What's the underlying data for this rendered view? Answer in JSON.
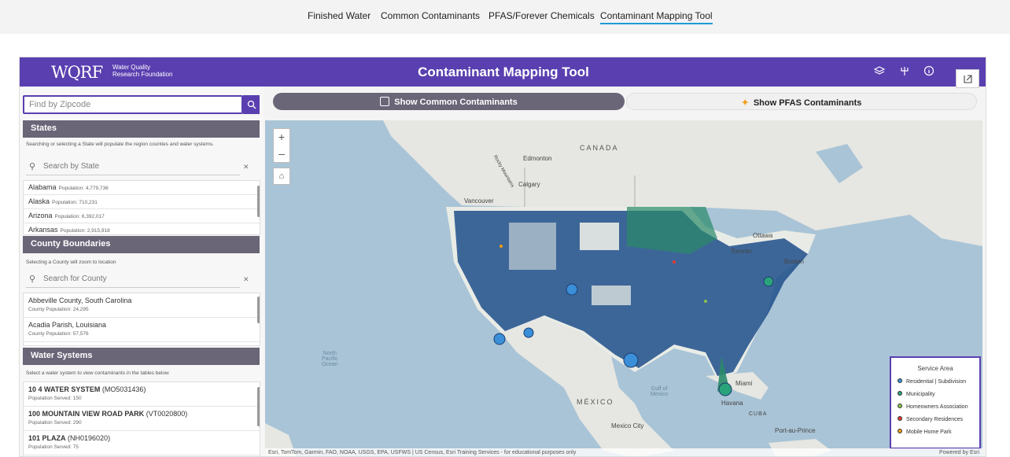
{
  "topnav": {
    "items": [
      {
        "label": "Finished Water"
      },
      {
        "label": "Common Contaminants"
      },
      {
        "label": "PFAS/Forever Chemicals"
      },
      {
        "label": "Contaminant Mapping Tool"
      }
    ]
  },
  "header": {
    "logo_text": "WQRF",
    "logo_sub_line1": "Water Quality",
    "logo_sub_line2": "Research Foundation",
    "title": "Contaminant Mapping Tool",
    "icons": [
      "layers-icon",
      "share-icon",
      "info-icon"
    ],
    "color": "#5a3fb0"
  },
  "zip_search": {
    "placeholder": "Find by Zipcode",
    "icon": "search-icon"
  },
  "states": {
    "title": "States",
    "description": "Searching or selecting a State will populate the region counties and water systems.",
    "filter_placeholder": "Search by State",
    "items": [
      {
        "name": "Alabama",
        "population": "Population: 4,779,736"
      },
      {
        "name": "Alaska",
        "population": "Population: 710,231"
      },
      {
        "name": "Arizona",
        "population": "Population: 6,392,017"
      },
      {
        "name": "Arkansas",
        "population": "Population: 2,915,918"
      }
    ]
  },
  "counties": {
    "title": "County Boundaries",
    "description": "Selecting a County will zoom to location",
    "filter_placeholder": "Search for County",
    "items": [
      {
        "name": "Abbeville County, South Carolina",
        "population": "County Population: 24,295"
      },
      {
        "name": "Acadia Parish, Louisiana",
        "population": "County Population: 57,576"
      }
    ]
  },
  "water_systems": {
    "title": "Water Systems",
    "description": "Select a water system to view contaminants in the tables below",
    "items": [
      {
        "name": "10 4 WATER SYSTEM",
        "code": "(MO5031436)",
        "served": "Population Served: 150"
      },
      {
        "name": "100 MOUNTAIN VIEW ROAD PARK",
        "code": "(VT0020800)",
        "served": "Population Served: 290"
      },
      {
        "name": "101 PLAZA",
        "code": "(NH0196020)",
        "served": "Population Served: 75"
      }
    ]
  },
  "toggles": {
    "common": "Show Common Contaminants",
    "pfas": "Show PFAS Contaminants"
  },
  "map": {
    "labels": {
      "canada": "CANADA",
      "edmonton": "Edmonton",
      "calgary": "Calgary",
      "vancouver": "Vancouver",
      "ottawa": "Ottawa",
      "toronto": "Toronto",
      "boston": "Boston",
      "mexico": "MÉXICO",
      "mexico_city": "Mexico City",
      "havana": "Havana",
      "cuba": "CUBA",
      "miami": "Miami",
      "port_au_prince": "Port-au-Prince",
      "rocky": "Rocky Mountains",
      "pacific_line1": "North",
      "pacific_line2": "Pacific",
      "pacific_line3": "Ocean",
      "gulf_line1": "Gulf of",
      "gulf_line2": "Mexico"
    },
    "attribution": "Esri, TomTom, Garmin, FAO, NOAA, USGS, EPA, USFWS | US Census, Esri Training Services - for educational purposes only",
    "powered_by": "Powered by Esri"
  },
  "legend": {
    "title": "Service Area",
    "items": [
      {
        "label": "Residential | Subdivision",
        "color": "#3a8fd8"
      },
      {
        "label": "Municipality",
        "color": "#2aa37a"
      },
      {
        "label": "Homeowners Association",
        "color": "#8bc34a"
      },
      {
        "label": "Secondary Residences",
        "color": "#e53935"
      },
      {
        "label": "Mobile Home Park",
        "color": "#f39c12"
      }
    ]
  }
}
